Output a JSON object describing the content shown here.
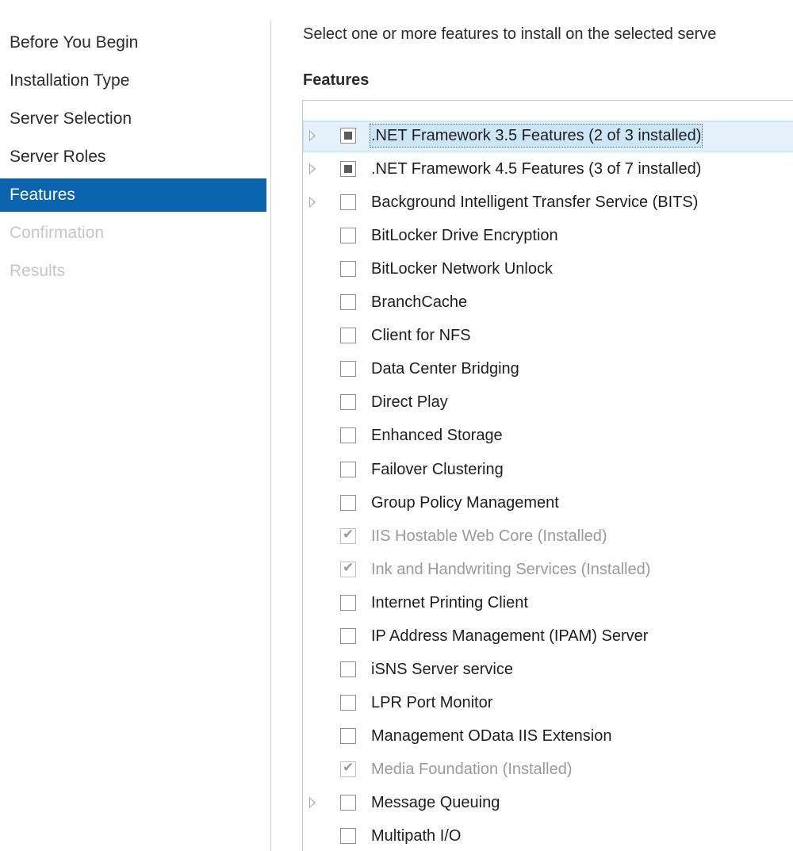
{
  "nav": {
    "items": [
      {
        "label": "Before You Begin",
        "state": "normal"
      },
      {
        "label": "Installation Type",
        "state": "normal"
      },
      {
        "label": "Server Selection",
        "state": "normal"
      },
      {
        "label": "Server Roles",
        "state": "normal"
      },
      {
        "label": "Features",
        "state": "active"
      },
      {
        "label": "Confirmation",
        "state": "disabled"
      },
      {
        "label": "Results",
        "state": "disabled"
      }
    ]
  },
  "main": {
    "instruction": "Select one or more features to install on the selected serve",
    "heading": "Features"
  },
  "features": [
    {
      "label": ".NET Framework 3.5 Features (2 of 3 installed)",
      "expandable": true,
      "check": "partial",
      "selected": true
    },
    {
      "label": ".NET Framework 4.5 Features (3 of 7 installed)",
      "expandable": true,
      "check": "partial",
      "selected": false
    },
    {
      "label": "Background Intelligent Transfer Service (BITS)",
      "expandable": true,
      "check": "unchecked",
      "selected": false
    },
    {
      "label": "BitLocker Drive Encryption",
      "expandable": false,
      "check": "unchecked",
      "selected": false
    },
    {
      "label": "BitLocker Network Unlock",
      "expandable": false,
      "check": "unchecked",
      "selected": false
    },
    {
      "label": "BranchCache",
      "expandable": false,
      "check": "unchecked",
      "selected": false
    },
    {
      "label": "Client for NFS",
      "expandable": false,
      "check": "unchecked",
      "selected": false
    },
    {
      "label": "Data Center Bridging",
      "expandable": false,
      "check": "unchecked",
      "selected": false
    },
    {
      "label": "Direct Play",
      "expandable": false,
      "check": "unchecked",
      "selected": false
    },
    {
      "label": "Enhanced Storage",
      "expandable": false,
      "check": "unchecked",
      "selected": false
    },
    {
      "label": "Failover Clustering",
      "expandable": false,
      "check": "unchecked",
      "selected": false
    },
    {
      "label": "Group Policy Management",
      "expandable": false,
      "check": "unchecked",
      "selected": false
    },
    {
      "label": "IIS Hostable Web Core (Installed)",
      "expandable": false,
      "check": "installed",
      "selected": false
    },
    {
      "label": "Ink and Handwriting Services (Installed)",
      "expandable": false,
      "check": "installed",
      "selected": false
    },
    {
      "label": "Internet Printing Client",
      "expandable": false,
      "check": "unchecked",
      "selected": false
    },
    {
      "label": "IP Address Management (IPAM) Server",
      "expandable": false,
      "check": "unchecked",
      "selected": false
    },
    {
      "label": "iSNS Server service",
      "expandable": false,
      "check": "unchecked",
      "selected": false
    },
    {
      "label": "LPR Port Monitor",
      "expandable": false,
      "check": "unchecked",
      "selected": false
    },
    {
      "label": "Management OData IIS Extension",
      "expandable": false,
      "check": "unchecked",
      "selected": false
    },
    {
      "label": "Media Foundation (Installed)",
      "expandable": false,
      "check": "installed",
      "selected": false
    },
    {
      "label": "Message Queuing",
      "expandable": true,
      "check": "unchecked",
      "selected": false
    },
    {
      "label": "Multipath I/O",
      "expandable": false,
      "check": "unchecked",
      "selected": false
    }
  ],
  "colors": {
    "accent": "#0a64ad",
    "selection": "#e5f1fb",
    "disabled_text": "#c6c6c6",
    "installed_text": "#9a9a9a"
  }
}
